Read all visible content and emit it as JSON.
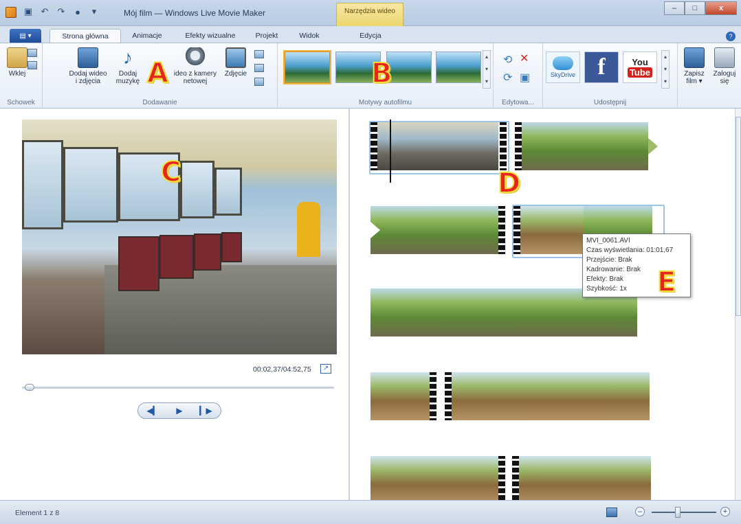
{
  "window": {
    "title": "Mój film — Windows Live Movie Maker",
    "context_tab_header": "Narzędzia wideo"
  },
  "tabs": [
    {
      "label": "Strona główna",
      "active": true
    },
    {
      "label": "Animacje"
    },
    {
      "label": "Efekty wizualne"
    },
    {
      "label": "Projekt"
    },
    {
      "label": "Widok"
    },
    {
      "label": "Edycja"
    }
  ],
  "ribbon": {
    "groups": {
      "clipboard": "Schowek",
      "add": "Dodawanie",
      "themes": "Motywy autofilmu",
      "edit": "Edytowa...",
      "share": "Udostępnij"
    },
    "paste": "Wklej",
    "add_video_photos": [
      "Dodaj wideo",
      "i zdjęcia"
    ],
    "add_music": [
      "Dodaj",
      "muzykę"
    ],
    "webcam": [
      "ideo z kamery",
      "netowej"
    ],
    "snapshot": "Zdjęcie",
    "skydrive": "SkyDrive",
    "facebook": "f",
    "youtube_you": "You",
    "youtube_tube": "Tube",
    "save_movie": [
      "Zapisz",
      "film ▾"
    ],
    "sign_in": [
      "Zaloguj",
      "się"
    ]
  },
  "markers": {
    "a": "A",
    "b": "B",
    "c": "C",
    "d": "D",
    "e": "E"
  },
  "preview": {
    "timecode": "00:02,37/04:52,75",
    "position": 0.008
  },
  "tooltip": {
    "lines": [
      "MVI_0061.AVI",
      "Czas wyświetlania: 01:01,67",
      "Przejście: Brak",
      "Kadrowanie: Brak",
      "Efekty: Brak",
      "Szybkość: 1x"
    ]
  },
  "status": {
    "text": "Element 1 z 8",
    "zoom_level": 0.4
  },
  "colors": {
    "marker_fill": "#e8241e",
    "marker_outline": "#f1df3e",
    "selection": "#9ec3ea"
  }
}
